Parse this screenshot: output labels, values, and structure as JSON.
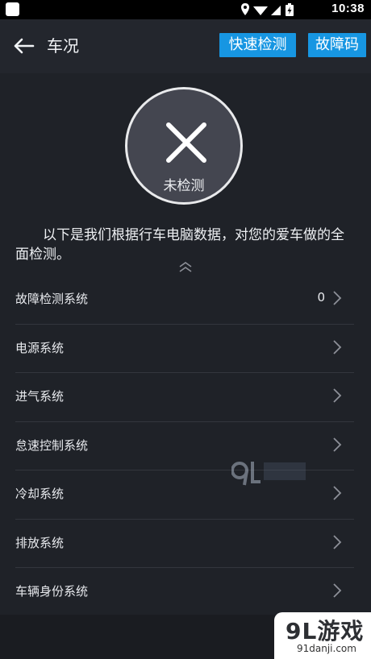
{
  "status_bar": {
    "time": "10:38"
  },
  "app_bar": {
    "title": "车况",
    "quick_check_label": "快速检测",
    "fault_code_label": "故障码"
  },
  "status_circle": {
    "label": "未检测"
  },
  "description": "以下是我们根据行车电脑数据，对您的爱车做的全面检测。",
  "systems": [
    {
      "name": "故障检测系统",
      "count": "0"
    },
    {
      "name": "电源系统",
      "count": ""
    },
    {
      "name": "进气系统",
      "count": ""
    },
    {
      "name": "怠速控制系统",
      "count": ""
    },
    {
      "name": "冷却系统",
      "count": ""
    },
    {
      "name": "排放系统",
      "count": ""
    },
    {
      "name": "车辆身份系统",
      "count": ""
    }
  ],
  "watermark": {
    "text": "9L游戏",
    "url": "91danji.com"
  },
  "colors": {
    "accent": "#1796e2",
    "background": "#1f2228"
  }
}
